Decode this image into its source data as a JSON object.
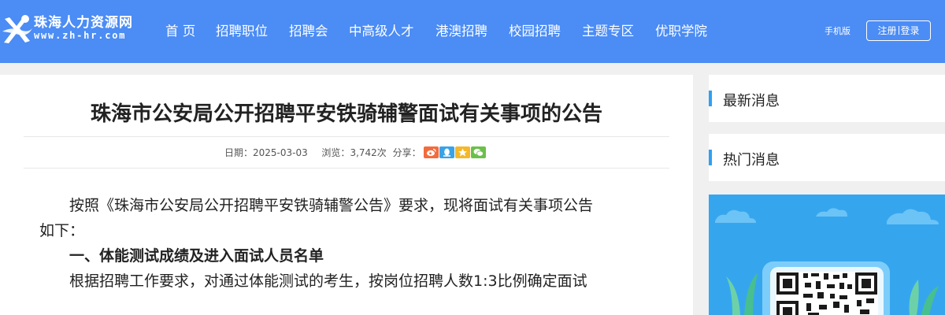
{
  "header": {
    "logo_name": "珠海人力资源网",
    "logo_url": "www.zh-hr.com",
    "nav": [
      "首 页",
      "招聘职位",
      "招聘会",
      "中高级人才",
      "港澳招聘",
      "校园招聘",
      "主题专区",
      "优职学院"
    ],
    "mobile_label": "手机版",
    "register_label": "注册",
    "login_label": "登录",
    "colors": {
      "bar": "#4b8cf5",
      "text": "#ffffff"
    }
  },
  "article": {
    "title": "珠海市公安局公开招聘平安铁骑辅警面试有关事项的公告",
    "date_label": "日期：",
    "date": "2025-03-03",
    "views_label": "浏览：",
    "views": "3,742次",
    "share_label": "分享：",
    "share_icons": [
      {
        "name": "weibo-icon",
        "color": "#f36b3e"
      },
      {
        "name": "qq-icon",
        "color": "#38a3e8"
      },
      {
        "name": "qzone-icon",
        "color": "#f5b82a"
      },
      {
        "name": "wechat-icon",
        "color": "#6cc04a"
      }
    ],
    "p1_line1": "按照《珠海市公安局公开招聘平安铁骑辅警公告》要求，现将面试有关事项公告",
    "p1_line2": "如下：",
    "heading1": "一、体能测试成绩及进入面试人员名单",
    "p2_line1": "根据招聘工作要求，对通过体能测试的考生，按岗位招聘人数1:3比例确定面试"
  },
  "sidebar": {
    "latest_title": "最新消息",
    "hot_title": "热门消息",
    "accent": "#2ea0f2",
    "promo_bg": "#35a6ee"
  }
}
